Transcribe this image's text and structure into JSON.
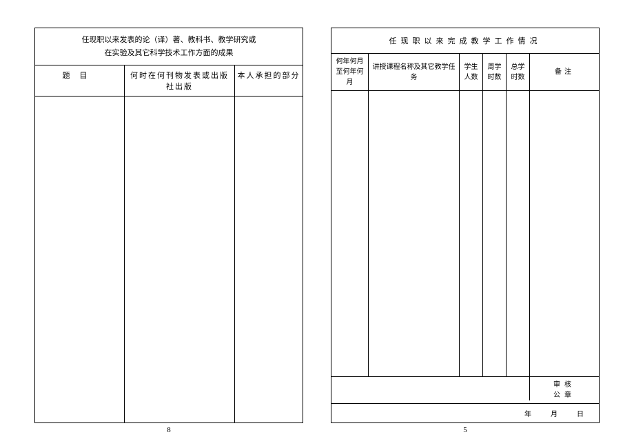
{
  "left": {
    "title_line1": "任现职以来发表的论（译）著、教科书、教学研究或",
    "title_line2": "在实验及其它科学技术工作方面的成果",
    "headers": {
      "col1": "题目",
      "col2": "何时在何刊物发表或出版社出版",
      "col3": "本人承担的部分"
    },
    "page_number": "8"
  },
  "right": {
    "title": "任现职以来完成教学工作情况",
    "headers": {
      "col1": "何年何月至何年何月",
      "col2": "讲授课程名称及其它教学任务",
      "col3": "学生人数",
      "col4": "周学时数",
      "col5": "总学时数",
      "col6": "备注"
    },
    "footer": {
      "seal_line1": "审核",
      "seal_line2": "公章",
      "date_year": "年",
      "date_month": "月",
      "date_day": "日"
    },
    "page_number": "5"
  }
}
